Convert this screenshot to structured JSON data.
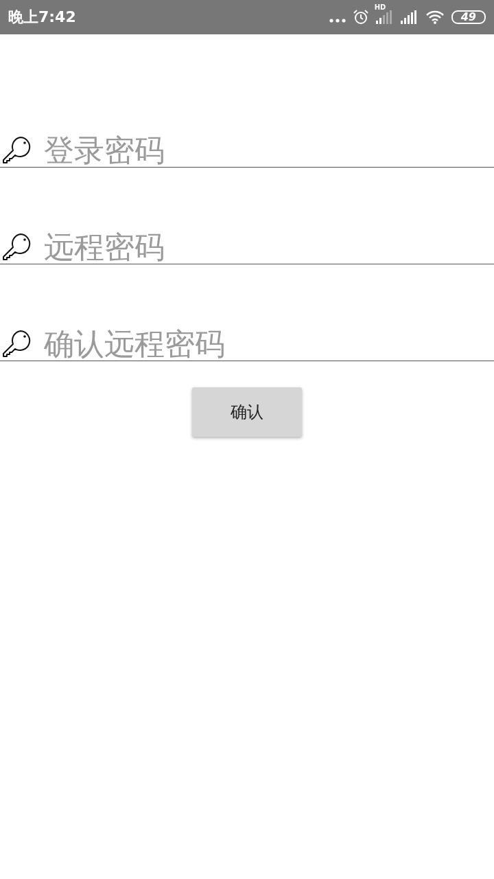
{
  "status_bar": {
    "time": "晚上7:42",
    "network_label": "HD",
    "battery": "49"
  },
  "fields": [
    {
      "placeholder": "登录密码"
    },
    {
      "placeholder": "远程密码"
    },
    {
      "placeholder": "确认远程密码"
    }
  ],
  "button": "确认"
}
